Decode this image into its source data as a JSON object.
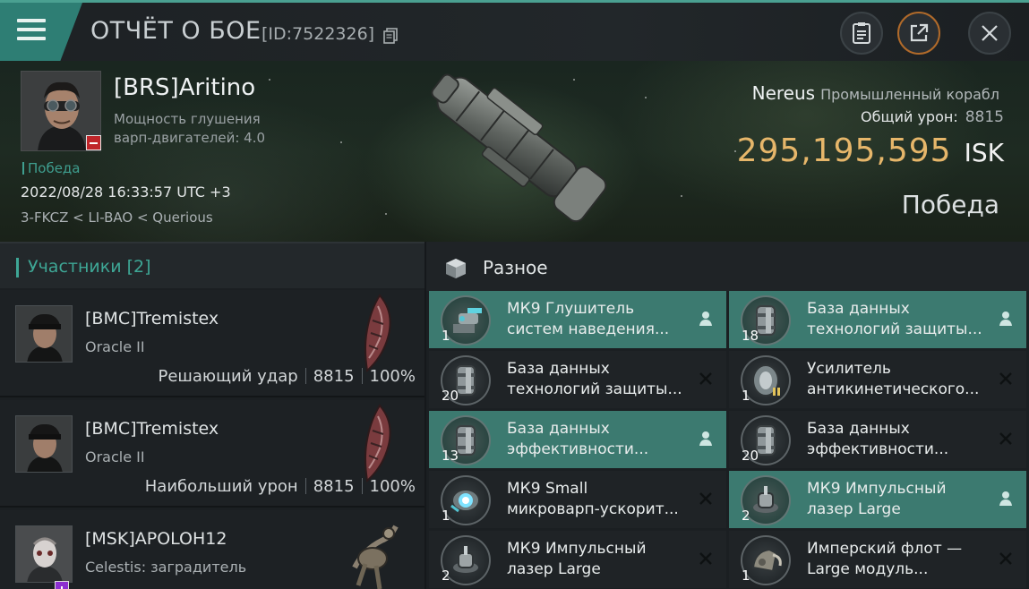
{
  "header": {
    "title": "ОТЧЁТ О БОЕ",
    "report_id": "[ID:7522326]"
  },
  "victim": {
    "pilot": "[BRS]Aritino",
    "stat_line1": "Мощность глушения",
    "stat_line2": "варп-двигателей: 4.0",
    "tag": "Победа",
    "datetime": "2022/08/28 16:33:57 UTC +3",
    "location": "3-FKCZ < LI-BAO < Querious",
    "ship_name": "Nereus",
    "ship_class": "Промышленный корабл",
    "damage_label": "Общий урон:",
    "damage_value": "8815",
    "isk_value": "295,195,595",
    "isk_unit": "ISK",
    "result": "Победа"
  },
  "participants": {
    "title": "Участники [2]",
    "list": [
      {
        "name": "[BMC]Tremistex",
        "ship": "Oracle II",
        "label": "Решающий удар",
        "damage": "8815",
        "percent": "100%"
      },
      {
        "name": "[BMC]Tremistex",
        "ship": "Oracle II",
        "label": "Наибольший урон",
        "damage": "8815",
        "percent": "100%"
      },
      {
        "name": "[MSK]APOLOH12",
        "ship": "Celestis: заградитель"
      }
    ]
  },
  "items": {
    "title": "Разное",
    "list": [
      {
        "line1": "МК9 Глушитель",
        "line2": "систем наведения...",
        "qty": "1",
        "state": "dropped",
        "icon": "turret-icon"
      },
      {
        "line1": "База данных",
        "line2": "технологий защиты...",
        "qty": "18",
        "state": "dropped",
        "icon": "canister-icon"
      },
      {
        "line1": "База данных",
        "line2": "технологий защиты...",
        "qty": "20",
        "state": "destroyed",
        "icon": "canister-icon"
      },
      {
        "line1": "Усилитель",
        "line2": "антикинетического...",
        "qty": "1",
        "state": "destroyed",
        "icon": "shield-amplifier-icon"
      },
      {
        "line1": "База данных",
        "line2": "эффективности...",
        "qty": "13",
        "state": "dropped",
        "icon": "canister-icon"
      },
      {
        "line1": "База данных",
        "line2": "эффективности...",
        "qty": "20",
        "state": "destroyed",
        "icon": "canister-icon"
      },
      {
        "line1": "МК9 Small",
        "line2": "микроварп-ускорит...",
        "qty": "1",
        "state": "destroyed",
        "icon": "microwarpdrive-icon"
      },
      {
        "line1": "МК9 Импульсный",
        "line2": "лазер Large",
        "qty": "2",
        "state": "dropped",
        "icon": "pulse-laser-icon"
      },
      {
        "line1": "МК9 Импульсный",
        "line2": "лазер Large",
        "qty": "2",
        "state": "destroyed",
        "icon": "pulse-laser-icon"
      },
      {
        "line1": "Имперский флот —",
        "line2": "Large модуль...",
        "qty": "1",
        "state": "destroyed",
        "icon": "module-icon"
      }
    ]
  },
  "colors": {
    "accent": "#3ea796",
    "dropped_bg": "#3c7a70",
    "isk": "#e6b66a",
    "badge_red": "#c0252a"
  }
}
